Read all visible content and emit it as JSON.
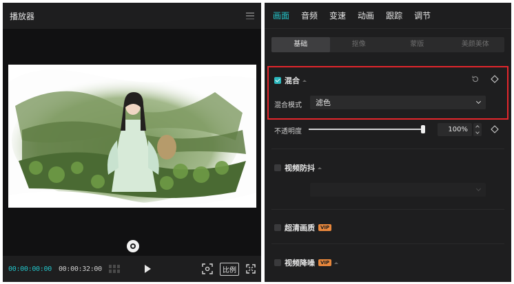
{
  "player": {
    "title": "播放器",
    "time_current": "00:00:00:00",
    "time_total": "00:00:32:00",
    "ratio_label": "比例"
  },
  "panel": {
    "tabs": [
      {
        "label": "画面",
        "active": true
      },
      {
        "label": "音频",
        "active": false
      },
      {
        "label": "变速",
        "active": false
      },
      {
        "label": "动画",
        "active": false
      },
      {
        "label": "跟踪",
        "active": false
      },
      {
        "label": "调节",
        "active": false
      }
    ],
    "subtabs": [
      {
        "label": "基础",
        "active": true
      },
      {
        "label": "抠像",
        "active": false
      },
      {
        "label": "蒙版",
        "active": false
      },
      {
        "label": "美颜美体",
        "active": false
      }
    ],
    "mix": {
      "title": "混合",
      "checked": true,
      "mode_label": "混合模式",
      "mode_value": "滤色"
    },
    "opacity": {
      "label": "不透明度",
      "value": "100%",
      "level": 1.0
    },
    "stabilize": {
      "title": "视频防抖",
      "checked": false
    },
    "hd": {
      "title": "超清画质",
      "vip": "VIP",
      "checked": false
    },
    "denoise": {
      "title": "视频降噪",
      "vip": "VIP",
      "checked": false
    }
  },
  "colors": {
    "accent": "#23c4c9",
    "highlight_border": "#e5262c",
    "panel_bg": "#1e1e1f"
  }
}
